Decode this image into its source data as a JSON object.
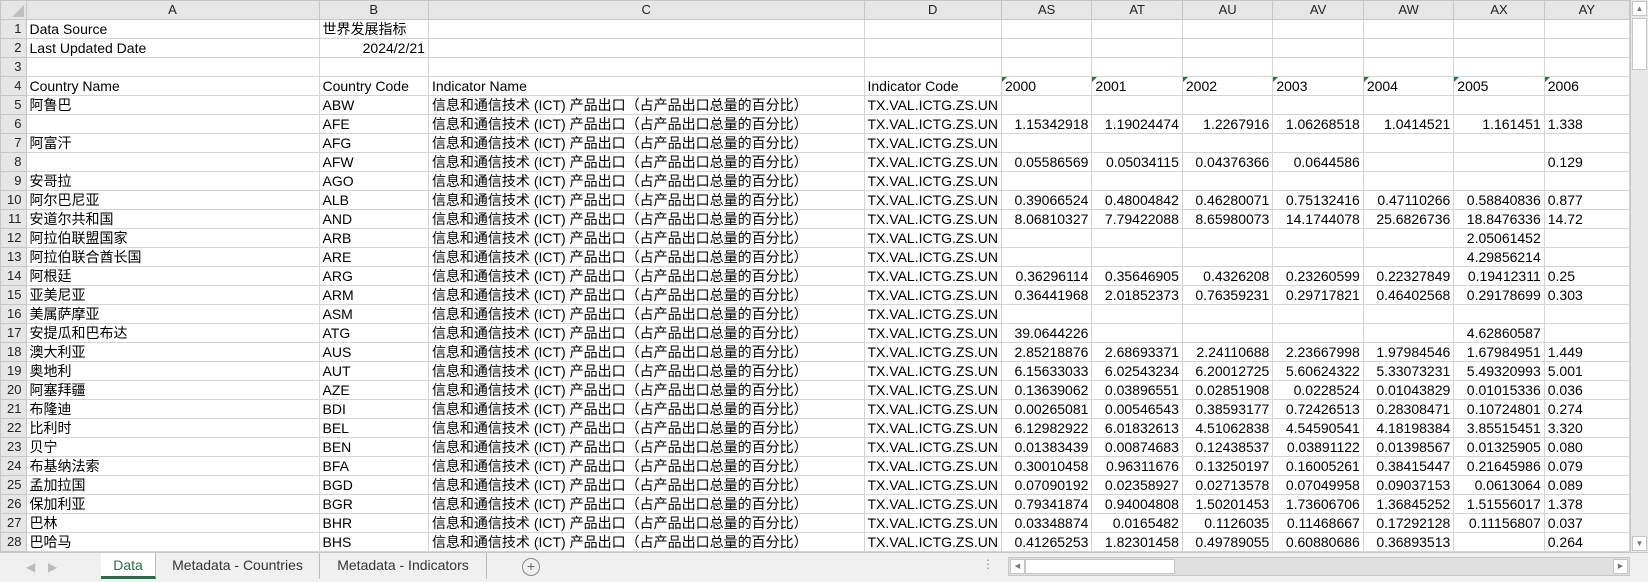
{
  "columns": [
    "A",
    "B",
    "C",
    "D",
    "AS",
    "AT",
    "AU",
    "AV",
    "AW",
    "AX",
    "AY"
  ],
  "header_rows": [
    {
      "num": "1",
      "a": "Data Source",
      "b": "世界发展指标",
      "c": "",
      "d": ""
    },
    {
      "num": "2",
      "a": "Last Updated Date",
      "b": "2024/2/21",
      "c": "",
      "d": ""
    },
    {
      "num": "3",
      "a": "",
      "b": "",
      "c": "",
      "d": ""
    },
    {
      "num": "4",
      "a": "Country Name",
      "b": "Country Code",
      "c": "Indicator Name",
      "d": "Indicator Code"
    }
  ],
  "years": [
    "2000",
    "2001",
    "2002",
    "2003",
    "2004",
    "2005",
    "2006"
  ],
  "indicator_name": "信息和通信技术 (ICT) 产品出口（占产品出口总量的百分比）",
  "indicator_code": "TX.VAL.ICTG.ZS.UN",
  "rows": [
    {
      "num": "5",
      "name": "阿鲁巴",
      "code": "ABW",
      "values": [
        "",
        "",
        "",
        "",
        "",
        "",
        ""
      ]
    },
    {
      "num": "6",
      "name": "",
      "code": "AFE",
      "values": [
        "1.15342918",
        "1.19024474",
        "1.2267916",
        "1.06268518",
        "1.0414521",
        "1.161451",
        "1.338"
      ]
    },
    {
      "num": "7",
      "name": "阿富汗",
      "code": "AFG",
      "values": [
        "",
        "",
        "",
        "",
        "",
        "",
        ""
      ]
    },
    {
      "num": "8",
      "name": "",
      "code": "AFW",
      "values": [
        "0.05586569",
        "0.05034115",
        "0.04376366",
        "0.0644586",
        "",
        "",
        "0.129"
      ]
    },
    {
      "num": "9",
      "name": "安哥拉",
      "code": "AGO",
      "values": [
        "",
        "",
        "",
        "",
        "",
        "",
        ""
      ]
    },
    {
      "num": "10",
      "name": "阿尔巴尼亚",
      "code": "ALB",
      "values": [
        "0.39066524",
        "0.48004842",
        "0.46280071",
        "0.75132416",
        "0.47110266",
        "0.58840836",
        "0.877"
      ]
    },
    {
      "num": "11",
      "name": "安道尔共和国",
      "code": "AND",
      "values": [
        "8.06810327",
        "7.79422088",
        "8.65980073",
        "14.1744078",
        "25.6826736",
        "18.8476336",
        "14.72"
      ]
    },
    {
      "num": "12",
      "name": "阿拉伯联盟国家",
      "code": "ARB",
      "values": [
        "",
        "",
        "",
        "",
        "",
        "2.05061452",
        ""
      ]
    },
    {
      "num": "13",
      "name": "阿拉伯联合酋长国",
      "code": "ARE",
      "values": [
        "",
        "",
        "",
        "",
        "",
        "4.29856214",
        ""
      ]
    },
    {
      "num": "14",
      "name": "阿根廷",
      "code": "ARG",
      "values": [
        "0.36296114",
        "0.35646905",
        "0.4326208",
        "0.23260599",
        "0.22327849",
        "0.19412311",
        "0.25"
      ]
    },
    {
      "num": "15",
      "name": "亚美尼亚",
      "code": "ARM",
      "values": [
        "0.36441968",
        "2.01852373",
        "0.76359231",
        "0.29717821",
        "0.46402568",
        "0.29178699",
        "0.303"
      ]
    },
    {
      "num": "16",
      "name": "美属萨摩亚",
      "code": "ASM",
      "values": [
        "",
        "",
        "",
        "",
        "",
        "",
        ""
      ]
    },
    {
      "num": "17",
      "name": "安提瓜和巴布达",
      "code": "ATG",
      "values": [
        "39.0644226",
        "",
        "",
        "",
        "",
        "4.62860587",
        ""
      ]
    },
    {
      "num": "18",
      "name": "澳大利亚",
      "code": "AUS",
      "values": [
        "2.85218876",
        "2.68693371",
        "2.24110688",
        "2.23667998",
        "1.97984546",
        "1.67984951",
        "1.449"
      ]
    },
    {
      "num": "19",
      "name": "奥地利",
      "code": "AUT",
      "values": [
        "6.15633033",
        "6.02543234",
        "6.20012725",
        "5.60624322",
        "5.33073231",
        "5.49320993",
        "5.001"
      ]
    },
    {
      "num": "20",
      "name": "阿塞拜疆",
      "code": "AZE",
      "values": [
        "0.13639062",
        "0.03896551",
        "0.02851908",
        "0.0228524",
        "0.01043829",
        "0.01015336",
        "0.036"
      ]
    },
    {
      "num": "21",
      "name": "布隆迪",
      "code": "BDI",
      "values": [
        "0.00265081",
        "0.00546543",
        "0.38593177",
        "0.72426513",
        "0.28308471",
        "0.10724801",
        "0.274"
      ]
    },
    {
      "num": "22",
      "name": "比利时",
      "code": "BEL",
      "values": [
        "6.12982922",
        "6.01832613",
        "4.51062838",
        "4.54590541",
        "4.18198384",
        "3.85515451",
        "3.320"
      ]
    },
    {
      "num": "23",
      "name": "贝宁",
      "code": "BEN",
      "values": [
        "0.01383439",
        "0.00874683",
        "0.12438537",
        "0.03891122",
        "0.01398567",
        "0.01325905",
        "0.080"
      ]
    },
    {
      "num": "24",
      "name": "布基纳法索",
      "code": "BFA",
      "values": [
        "0.30010458",
        "0.96311676",
        "0.13250197",
        "0.16005261",
        "0.38415447",
        "0.21645986",
        "0.079"
      ]
    },
    {
      "num": "25",
      "name": "孟加拉国",
      "code": "BGD",
      "values": [
        "0.07090192",
        "0.02358927",
        "0.02713578",
        "0.07049958",
        "0.09037153",
        "0.0613064",
        "0.089"
      ]
    },
    {
      "num": "26",
      "name": "保加利亚",
      "code": "BGR",
      "values": [
        "0.79341874",
        "0.94004808",
        "1.50201453",
        "1.73606706",
        "1.36845252",
        "1.51556017",
        "1.378"
      ]
    },
    {
      "num": "27",
      "name": "巴林",
      "code": "BHR",
      "values": [
        "0.03348874",
        "0.0165482",
        "0.1126035",
        "0.11468667",
        "0.17292128",
        "0.11156807",
        "0.037"
      ]
    },
    {
      "num": "28",
      "name": "巴哈马",
      "code": "BHS",
      "values": [
        "0.41265253",
        "1.82301458",
        "0.49789055",
        "0.60880686",
        "0.36893513",
        "",
        "0.264"
      ]
    }
  ],
  "sheet_tabs": [
    {
      "label": "Data",
      "active": true
    },
    {
      "label": "Metadata - Countries",
      "active": false
    },
    {
      "label": "Metadata - Indicators",
      "active": false
    }
  ],
  "add_sheet_icon": "plus-circle-icon",
  "accent_color": "#1e7145"
}
